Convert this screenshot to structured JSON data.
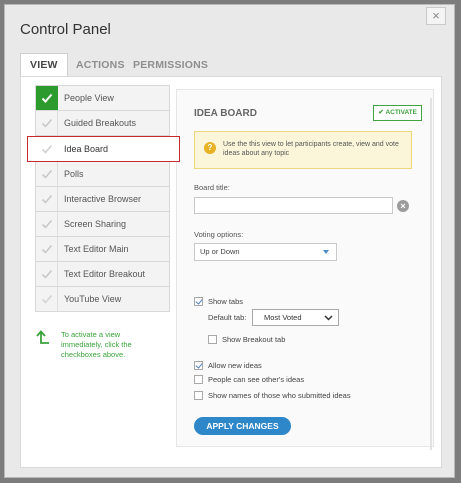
{
  "dialog": {
    "title": "Control Panel",
    "close_glyph": "×"
  },
  "tabs": [
    {
      "label": "VIEW",
      "active": true
    },
    {
      "label": "ACTIONS"
    },
    {
      "label": "PERMISSIONS"
    }
  ],
  "sidebar": {
    "items": [
      {
        "label": "People View",
        "state": "checked-active"
      },
      {
        "label": "Guided Breakouts",
        "state": "checked"
      },
      {
        "label": "Idea Board",
        "state": "selected"
      },
      {
        "label": "Polls",
        "state": "checked"
      },
      {
        "label": "Interactive Browser",
        "state": "checked"
      },
      {
        "label": "Screen Sharing",
        "state": "checked"
      },
      {
        "label": "Text Editor Main",
        "state": "checked"
      },
      {
        "label": "Text Editor Breakout",
        "state": "checked"
      },
      {
        "label": "YouTube View",
        "state": "checked"
      }
    ],
    "hint": "To activate a view immediately, click the checkboxes above."
  },
  "panel": {
    "heading": "IDEA BOARD",
    "activate_label": "ACTIVATE",
    "notice_icon": "?",
    "notice": "Use the this view to let participants create, view and vote ideas about any topic",
    "board_title_label": "Board title:",
    "board_title_value": "",
    "clear_glyph": "×",
    "voting_label": "Voting options:",
    "voting_value": "Up or Down",
    "show_tabs": {
      "label": "Show tabs",
      "checked": true
    },
    "default_tab_label": "Default tab:",
    "default_tab_value": "Most Voted",
    "show_breakout_tab": {
      "label": "Show Breakout tab",
      "checked": false
    },
    "allow_new_ideas": {
      "label": "Allow new ideas",
      "checked": true
    },
    "see_others": {
      "label": "People can see other's ideas",
      "checked": false
    },
    "show_names": {
      "label": "Show names of those who submitted ideas",
      "checked": false
    },
    "apply_label": "APPLY CHANGES"
  },
  "colors": {
    "accent_green": "#2d9a2d",
    "selection_red": "#c92b2b",
    "button_blue": "#2e87c9"
  }
}
